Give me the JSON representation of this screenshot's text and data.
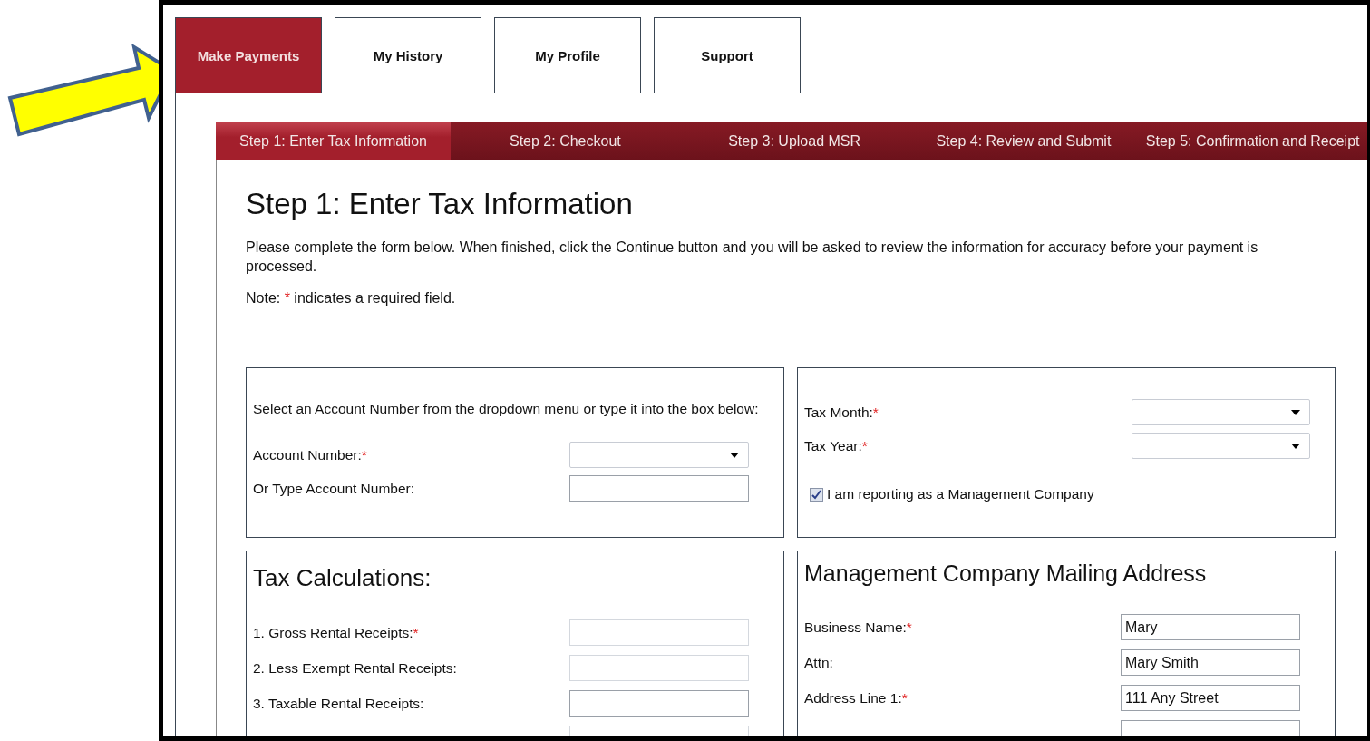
{
  "tabs": [
    {
      "label": "Make Payments",
      "selected": true
    },
    {
      "label": "My History",
      "selected": false
    },
    {
      "label": "My Profile",
      "selected": false
    },
    {
      "label": "Support",
      "selected": false
    }
  ],
  "steps": [
    {
      "label": "Step 1: Enter Tax Information",
      "selected": true
    },
    {
      "label": "Step 2: Checkout",
      "selected": false
    },
    {
      "label": "Step 3: Upload MSR",
      "selected": false
    },
    {
      "label": "Step 4: Review and Submit",
      "selected": false
    },
    {
      "label": "Step 5: Confirmation and Receipt",
      "selected": false
    }
  ],
  "heading": "Step 1: Enter Tax Information",
  "intro": "Please complete the form below. When finished, click the Continue button and you will be asked to review the information for accuracy before your payment is processed.",
  "note": {
    "before": "Note: ",
    "mark": "*",
    "after": " indicates a required field."
  },
  "account_panel": {
    "instruction": "Select an Account Number from the dropdown menu or type it into the box below:",
    "fields": [
      {
        "kind": "select",
        "label": "Account Number:",
        "required": true
      },
      {
        "kind": "text",
        "label": "Or Type Account Number:",
        "required": false
      }
    ]
  },
  "period_panel": {
    "fields": [
      {
        "kind": "select",
        "label": "Tax Month:",
        "required": true
      },
      {
        "kind": "select",
        "label": "Tax Year:",
        "required": true
      }
    ],
    "checkbox": {
      "label": "I am reporting as a Management Company",
      "checked": true
    }
  },
  "tax_panel": {
    "title": "Tax Calculations:",
    "fields": [
      {
        "kind": "text",
        "label": "1. Gross Rental Receipts:",
        "required": true,
        "disabled": true
      },
      {
        "kind": "text",
        "label": "2. Less Exempt Rental Receipts:",
        "required": false,
        "disabled": true
      },
      {
        "kind": "text",
        "label": "3. Taxable Rental Receipts:",
        "required": false,
        "disabled": false
      },
      {
        "kind": "text",
        "disabled": true
      }
    ]
  },
  "address_panel": {
    "title": "Management Company Mailing Address",
    "fields": [
      {
        "kind": "text",
        "label": "Business Name:",
        "required": true,
        "value": "Mary"
      },
      {
        "kind": "text",
        "label": "Attn:",
        "required": false,
        "value": "Mary Smith"
      },
      {
        "kind": "text",
        "label": "Address Line 1:",
        "required": true,
        "value": "111 Any Street"
      },
      {
        "kind": "text"
      }
    ]
  }
}
